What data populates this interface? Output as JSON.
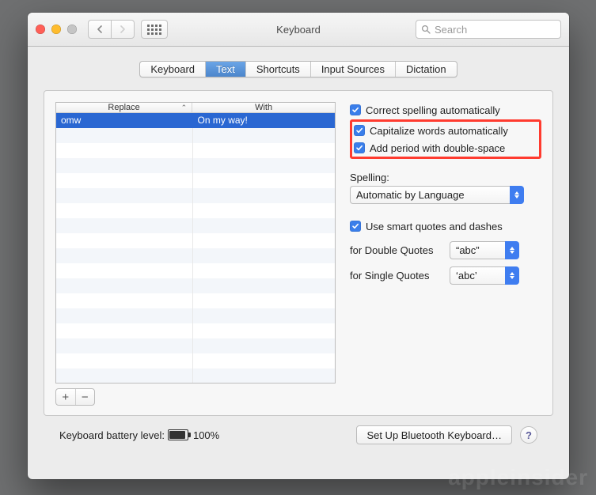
{
  "window": {
    "title": "Keyboard"
  },
  "toolbar": {
    "search_placeholder": "Search"
  },
  "tabs": [
    {
      "label": "Keyboard",
      "active": false
    },
    {
      "label": "Text",
      "active": true
    },
    {
      "label": "Shortcuts",
      "active": false
    },
    {
      "label": "Input Sources",
      "active": false
    },
    {
      "label": "Dictation",
      "active": false
    }
  ],
  "table": {
    "columns": {
      "replace": "Replace",
      "with": "With"
    },
    "rows": [
      {
        "replace": "omw",
        "with": "On my way!",
        "selected": true
      }
    ],
    "empty_row_count": 17
  },
  "options": {
    "correct_spelling": {
      "label": "Correct spelling automatically",
      "checked": true
    },
    "capitalize": {
      "label": "Capitalize words automatically",
      "checked": true
    },
    "double_space_period": {
      "label": "Add period with double-space",
      "checked": true
    },
    "spelling_label": "Spelling:",
    "spelling_value": "Automatic by Language",
    "smart_quotes": {
      "label": "Use smart quotes and dashes",
      "checked": true
    },
    "double_quotes_label": "for Double Quotes",
    "double_quotes_value": "“abc”",
    "single_quotes_label": "for Single Quotes",
    "single_quotes_value": "‘abc’"
  },
  "footer": {
    "battery_label": "Keyboard battery level:",
    "battery_percent": "100%",
    "bluetooth_button": "Set Up Bluetooth Keyboard…"
  },
  "watermark": "appleinsider"
}
